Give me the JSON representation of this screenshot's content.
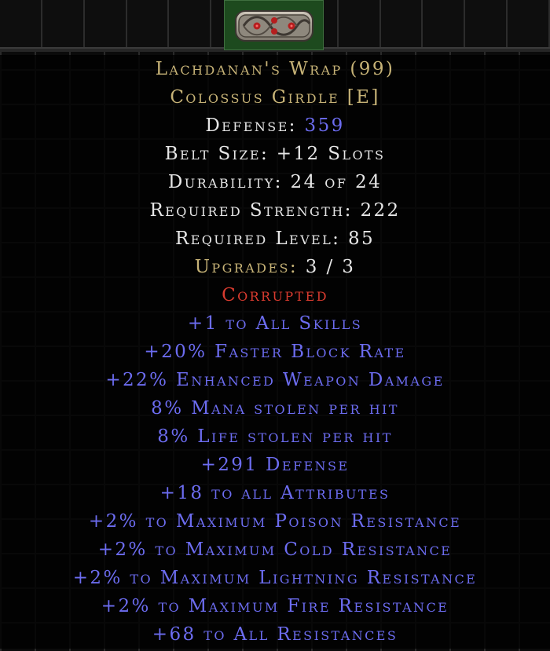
{
  "item": {
    "name": "Lachdanan's Wrap (99)",
    "base": "Colossus Girdle [E]",
    "defense_label": "Defense: ",
    "defense_value": "359",
    "belt_size": "Belt Size: +12 Slots",
    "durability": "Durability: 24 of 24",
    "req_strength": "Required Strength: 222",
    "req_level": "Required Level: 85",
    "upgrades_label": "Upgrades: ",
    "upgrades_value": "3 / 3",
    "corrupted": "Corrupted",
    "mods": [
      "+1 to All Skills",
      "+20% Faster Block Rate",
      "+22% Enhanced Weapon Damage",
      "8% Mana stolen per hit",
      "8% Life stolen per hit",
      "+291 Defense",
      "+18 to all Attributes",
      "+2% to Maximum Poison Resistance",
      "+2% to Maximum Cold Resistance",
      "+2% to Maximum Lightning Resistance",
      "+2% to Maximum Fire Resistance",
      "+68 to All Resistances"
    ]
  },
  "icons": {
    "item_icon": "belt-icon"
  },
  "colors": {
    "name": "#c7b377",
    "stats": "#e6e6e6",
    "corrupted": "#d83b2f",
    "magic": "#6c6cf0",
    "slot_bg": "#1d4a1e"
  }
}
